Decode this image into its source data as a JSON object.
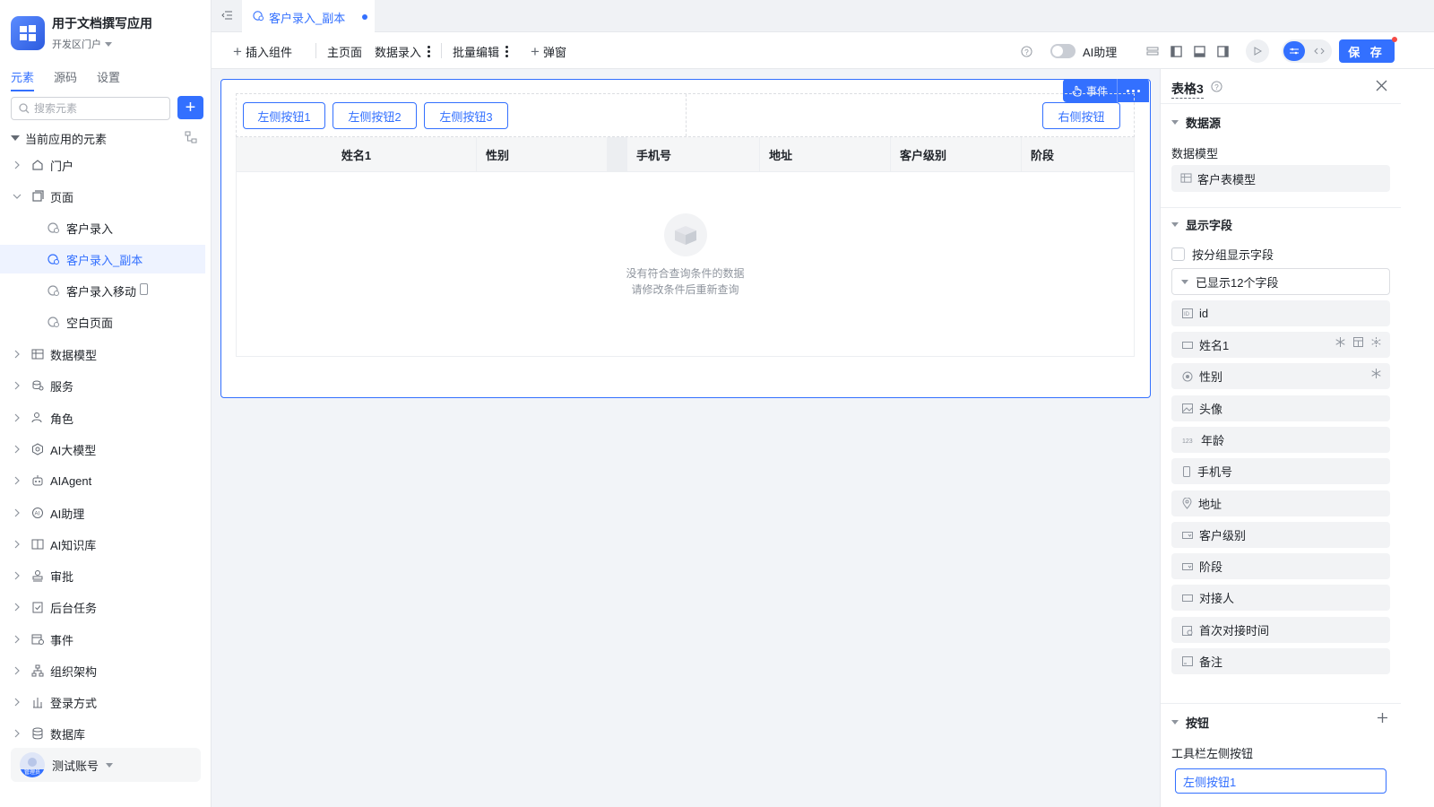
{
  "app": {
    "name": "用于文档撰写应用",
    "env": "开发区门户"
  },
  "sidebar": {
    "tabs": [
      "元素",
      "源码",
      "设置"
    ],
    "search_placeholder": "搜索元素",
    "tree_root": "当前应用的元素",
    "items": [
      {
        "label": "门户",
        "icon": "home-icon"
      },
      {
        "label": "页面",
        "icon": "pages-icon"
      },
      {
        "label": "客户录入",
        "icon": "page-icon"
      },
      {
        "label": "客户录入_副本",
        "icon": "page-icon"
      },
      {
        "label": "客户录入移动",
        "icon": "page-icon"
      },
      {
        "label": "空白页面",
        "icon": "page-icon"
      },
      {
        "label": "数据模型",
        "icon": "table-icon"
      },
      {
        "label": "服务",
        "icon": "service-icon"
      },
      {
        "label": "角色",
        "icon": "role-icon"
      },
      {
        "label": "AI大模型",
        "icon": "ai-model-icon"
      },
      {
        "label": "AIAgent",
        "icon": "robot-icon"
      },
      {
        "label": "AI助理",
        "icon": "ai-assistant-icon"
      },
      {
        "label": "AI知识库",
        "icon": "knowledge-icon"
      },
      {
        "label": "审批",
        "icon": "approval-icon"
      },
      {
        "label": "后台任务",
        "icon": "task-icon"
      },
      {
        "label": "事件",
        "icon": "event-icon"
      },
      {
        "label": "组织架构",
        "icon": "org-icon"
      },
      {
        "label": "登录方式",
        "icon": "login-icon"
      },
      {
        "label": "数据库",
        "icon": "database-icon"
      }
    ],
    "user": {
      "name": "测试账号",
      "role_tag": "管理员"
    }
  },
  "tabbar": {
    "active_tab": "客户录入_副本"
  },
  "toolbar": {
    "insert": "插入组件",
    "home": "主页面",
    "data_entry": "数据录入",
    "batch_edit": "批量编辑",
    "popup": "弹窗",
    "ai_assistant": "AI助理",
    "save": "保 存"
  },
  "canvas": {
    "event_label": "事件",
    "left_buttons": [
      "左侧按钮1",
      "左侧按钮2",
      "左侧按钮3"
    ],
    "right_button": "右侧按钮",
    "columns": [
      "姓名1",
      "性别",
      "手机号",
      "地址",
      "客户级别",
      "阶段"
    ],
    "empty_line1": "没有符合查询条件的数据",
    "empty_line2": "请修改条件后重新查询"
  },
  "panel": {
    "title": "表格3",
    "datasource_section": "数据源",
    "model_label": "数据模型",
    "model_value": "客户表模型",
    "fields_section": "显示字段",
    "group_checkbox": "按分组显示字段",
    "fields_summary": "已显示12个字段",
    "fields": [
      {
        "label": "id",
        "icon": "id-icon"
      },
      {
        "label": "姓名1",
        "icon": "text-field-icon"
      },
      {
        "label": "性别",
        "icon": "radio-icon"
      },
      {
        "label": "头像",
        "icon": "image-icon"
      },
      {
        "label": "年龄",
        "icon": "number-icon"
      },
      {
        "label": "手机号",
        "icon": "phone-icon"
      },
      {
        "label": "地址",
        "icon": "location-icon"
      },
      {
        "label": "客户级别",
        "icon": "select-icon"
      },
      {
        "label": "阶段",
        "icon": "select-icon"
      },
      {
        "label": "对接人",
        "icon": "text-field-icon"
      },
      {
        "label": "首次对接时间",
        "icon": "datetime-icon"
      },
      {
        "label": "备注",
        "icon": "textarea-icon"
      }
    ],
    "buttons_section": "按钮",
    "toolbar_left_label": "工具栏左侧按钮",
    "toolbar_left_value": "左侧按钮1"
  },
  "colors": {
    "accent": "#3370ff",
    "danger": "#f54a45"
  }
}
